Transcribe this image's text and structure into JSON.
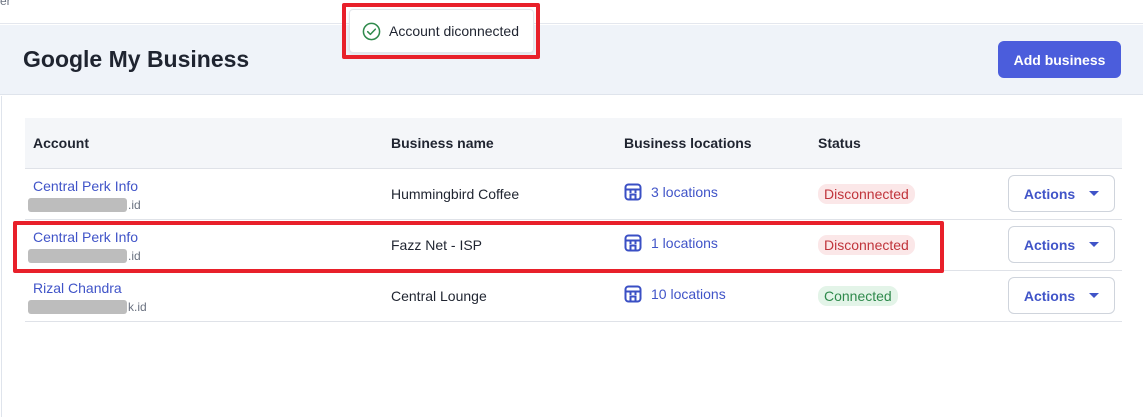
{
  "crumb": "er",
  "header": {
    "title": "Google My Business",
    "add_label": "Add business"
  },
  "toast": {
    "message": "Account diconnected",
    "icon": "check-circle-icon"
  },
  "table": {
    "columns": [
      "Account",
      "Business name",
      "Business locations",
      "Status"
    ],
    "rows": [
      {
        "account_name": "Central Perk Info",
        "account_suffix": ".id",
        "business": "Hummingbird Coffee",
        "locations": "3 locations",
        "status": "Disconnected",
        "status_type": "bad",
        "action": "Actions"
      },
      {
        "account_name": "Central Perk Info",
        "account_suffix": ".id",
        "business": "Fazz Net - ISP",
        "locations": "1 locations",
        "status": "Disconnected",
        "status_type": "bad",
        "action": "Actions"
      },
      {
        "account_name": "Rizal Chandra",
        "account_suffix": "k.id",
        "business": "Central Lounge",
        "locations": "10 locations",
        "status": "Connected",
        "status_type": "good",
        "action": "Actions"
      }
    ]
  },
  "colors": {
    "accent": "#4b5ddc",
    "link": "#4054c8",
    "highlight": "#e8202a"
  }
}
